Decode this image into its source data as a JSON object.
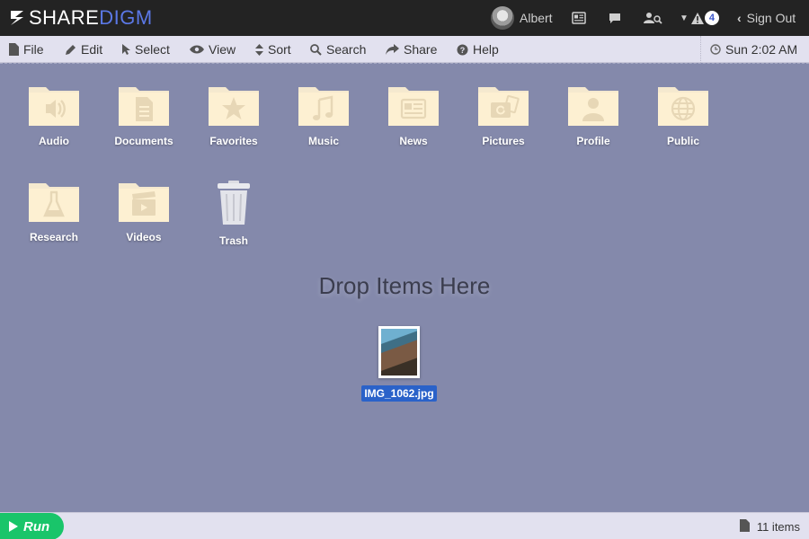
{
  "app": {
    "logo_part1": "SHARE",
    "logo_part2": "DIGM",
    "brand_color": "#5b78e6"
  },
  "topbar": {
    "user_name": "Albert",
    "notifications_count": "4",
    "signout_label": "Sign Out",
    "icons": [
      "newspaper-icon",
      "chat-icon",
      "user-search-icon",
      "caret-down-icon",
      "warning-icon"
    ]
  },
  "menubar": {
    "items": [
      {
        "label": "File",
        "icon": "file-icon"
      },
      {
        "label": "Edit",
        "icon": "pencil-icon"
      },
      {
        "label": "Select",
        "icon": "cursor-icon"
      },
      {
        "label": "View",
        "icon": "eye-icon"
      },
      {
        "label": "Sort",
        "icon": "sort-icon"
      },
      {
        "label": "Search",
        "icon": "search-icon"
      },
      {
        "label": "Share",
        "icon": "share-icon"
      },
      {
        "label": "Help",
        "icon": "help-icon"
      }
    ],
    "clock": "Sun 2:02 AM"
  },
  "desktop": {
    "folders": [
      {
        "label": "Audio",
        "icon": "speaker-icon"
      },
      {
        "label": "Documents",
        "icon": "document-icon"
      },
      {
        "label": "Favorites",
        "icon": "star-icon"
      },
      {
        "label": "Music",
        "icon": "music-note-icon"
      },
      {
        "label": "News",
        "icon": "newspaper-icon"
      },
      {
        "label": "Pictures",
        "icon": "camera-icon"
      },
      {
        "label": "Profile",
        "icon": "person-icon"
      },
      {
        "label": "Public",
        "icon": "globe-icon"
      },
      {
        "label": "Research",
        "icon": "flask-icon"
      },
      {
        "label": "Videos",
        "icon": "clapperboard-icon"
      }
    ],
    "trash_label": "Trash",
    "drop_text": "Drop Items Here",
    "file_label": "IMG_1062.jpg"
  },
  "bottombar": {
    "run_label": "Run",
    "item_count": "11 items"
  }
}
